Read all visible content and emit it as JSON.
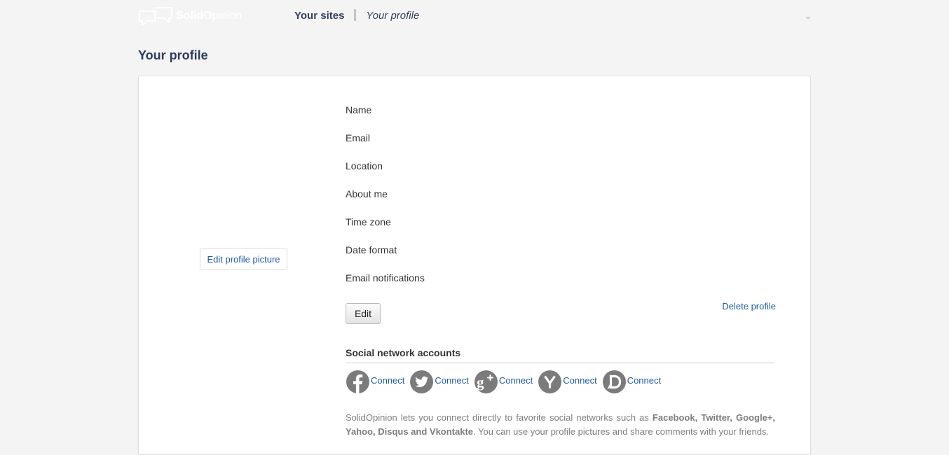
{
  "header": {
    "logo": {
      "brand_bold": "Solid",
      "brand_regular": "Opinion",
      "icon": "speech-bubbles-logo-icon"
    },
    "nav": {
      "your_sites": "Your sites",
      "your_profile": "Your profile"
    },
    "user_menu_icon": "caret-down-icon"
  },
  "page_title": "Your profile",
  "profile_picture": {
    "edit_label": "Edit profile picture"
  },
  "fields": [
    {
      "label": "Name"
    },
    {
      "label": "Email"
    },
    {
      "label": "Location"
    },
    {
      "label": "About me"
    },
    {
      "label": "Time zone"
    },
    {
      "label": "Date format"
    },
    {
      "label": "Email notifications"
    }
  ],
  "actions": {
    "edit_label": "Edit",
    "delete_label": "Delete profile"
  },
  "social": {
    "heading": "Social network accounts",
    "accounts": [
      {
        "network": "facebook",
        "icon": "facebook-icon",
        "connect_label": "Connect"
      },
      {
        "network": "twitter",
        "icon": "twitter-icon",
        "connect_label": "Connect"
      },
      {
        "network": "google-plus",
        "icon": "google-plus-icon",
        "connect_label": "Connect"
      },
      {
        "network": "yahoo",
        "icon": "yahoo-icon",
        "connect_label": "Connect"
      },
      {
        "network": "disqus",
        "icon": "disqus-icon",
        "connect_label": "Connect"
      }
    ],
    "info": {
      "text_before": "SolidOpinion lets you connect directly to favorite social networks such as ",
      "networks_bold": "Facebook, Twitter, Google+, Yahoo, Disqus and Vkontakte",
      "text_after": ". You can use your profile pictures and share comments with your friends."
    }
  },
  "colors": {
    "page_background": "#f4f4f4",
    "title": "#2e3b5e",
    "link": "#1f5aa0",
    "social_icon": "#7b7b7b",
    "card_border": "#dedede"
  }
}
